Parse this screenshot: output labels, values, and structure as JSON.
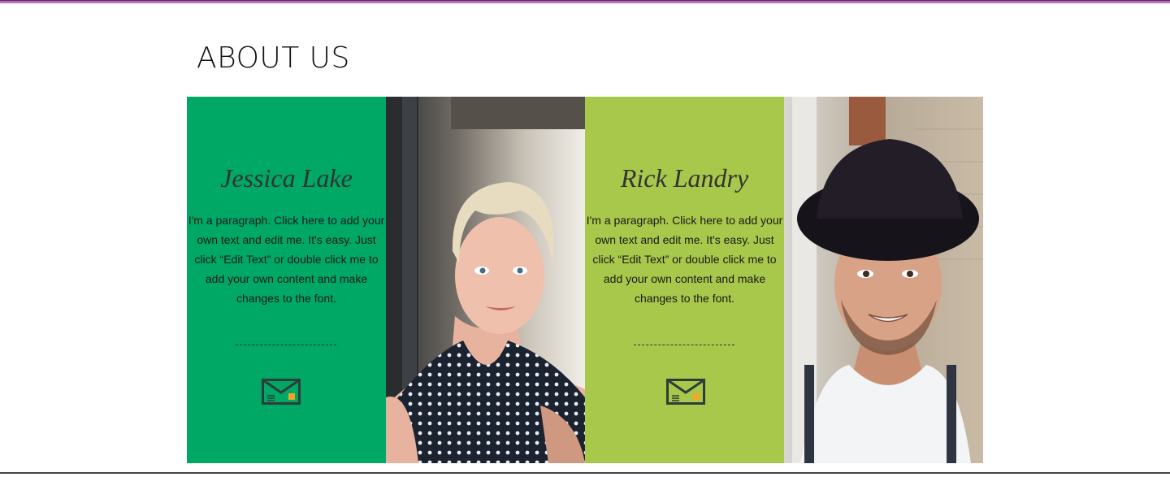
{
  "page": {
    "title": "ABOUT US"
  },
  "team": [
    {
      "name": "Jessica Lake",
      "bio": "I'm a paragraph. Click here to add your own text and edit me. It's easy. Just click “Edit Text” or double click me to add your own content and make changes to the font.",
      "card_color": "#00a865",
      "photo_icon": "portrait-photo"
    },
    {
      "name": "Rick Landry",
      "bio": "I'm a paragraph. Click here to add your own text and edit me. It's easy. Just click “Edit Text” or double click me to add your own content and make changes to the font.",
      "card_color": "#a8c84b",
      "photo_icon": "portrait-photo"
    }
  ],
  "colors": {
    "accent_line": "#7a1f7a",
    "mail_icon_stroke": "#2e3d3b",
    "mail_icon_stamp": "#f5a623"
  }
}
